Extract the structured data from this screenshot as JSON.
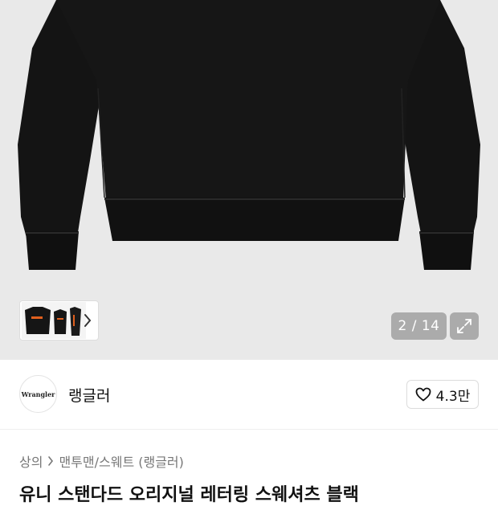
{
  "gallery": {
    "counter": "2 / 14",
    "thumb_label": "Wrangler"
  },
  "brand": {
    "logo_text": "Wrangler",
    "name": "랭글러",
    "likes": "4.3만"
  },
  "breadcrumb": {
    "category": "상의",
    "subcategory": "맨투맨/스웨트 (랭글러)"
  },
  "product": {
    "title": "유니 스탠다드 오리지널 레터링 스웨셔츠 블랙"
  },
  "colors": {
    "garment": "#141414",
    "gallery_bg": "#e9e9e9"
  }
}
